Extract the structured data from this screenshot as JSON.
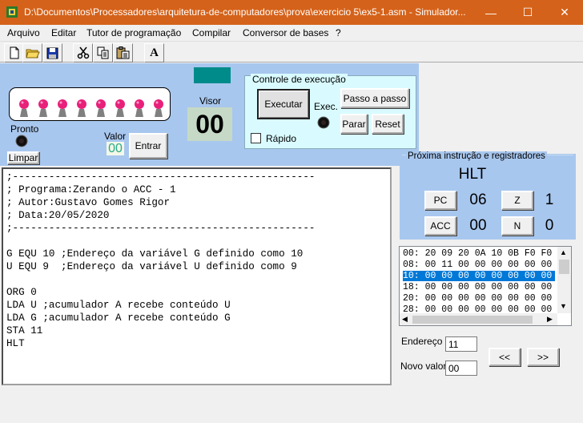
{
  "window": {
    "title": "D:\\Documentos\\Processadores\\arquitetura-de-computadores\\prova\\exercicio 5\\ex5-1.asm - Simulador...",
    "minimize": "—",
    "maximize": "☐",
    "close": "✕"
  },
  "menu": [
    "Arquivo",
    "Editar",
    "Tutor de programação",
    "Compilar",
    "Conversor de bases",
    "?"
  ],
  "toolbar": {
    "font_button": "A"
  },
  "io_panel": {
    "pronto_label": "Pronto",
    "limpar_button": "Limpar",
    "valor_label": "Valor",
    "valor_value": "00",
    "entrar_button": "Entrar",
    "visor_label": "Visor",
    "visor_value": "00"
  },
  "execution": {
    "group_title": "Controle de execução",
    "executar_button": "Executar",
    "exec_label": "Exec.",
    "passo_button": "Passo a passo",
    "parar_button": "Parar",
    "reset_button": "Reset",
    "rapido_label": "Rápido",
    "rapido_checked": false
  },
  "registers": {
    "group_title": "Próxima instrução e registradores",
    "instruction": "HLT",
    "pc_label": "PC",
    "pc_value": "06",
    "z_label": "Z",
    "z_value": "1",
    "acc_label": "ACC",
    "acc_value": "00",
    "n_label": "N",
    "n_value": "0"
  },
  "editor": {
    "lines": [
      ";--------------------------------------------------",
      "; Programa:Zerando o ACC - 1",
      "; Autor:Gustavo Gomes Rigor",
      "; Data:20/05/2020",
      ";--------------------------------------------------",
      "",
      "G EQU 10 ;Endereço da variável G definido como 10",
      "U EQU 9  ;Endereço da variável U definido como 9",
      "",
      "ORG 0",
      "LDA U ;acumulador A recebe conteúdo U",
      "LDA G ;acumulador A recebe conteúdo G",
      "STA 11",
      "HLT"
    ]
  },
  "memory": {
    "lines": [
      "00: 20 09 20 0A 10 0B F0 F0",
      "08: 00 11 00 00 00 00 00 00",
      "10: 00 00 00 00 00 00 00 00",
      "18: 00 00 00 00 00 00 00 00",
      "20: 00 00 00 00 00 00 00 00",
      "28: 00 00 00 00 00 00 00 00"
    ],
    "selected_index": 2
  },
  "memory_edit": {
    "endereco_label": "Endereço",
    "endereco_value": "11",
    "novo_valor_label": "Novo valor",
    "novo_valor_value": "00",
    "prev_button": "<<",
    "next_button": ">>"
  },
  "colors": {
    "titlebar": "#d5621a",
    "panel_blue": "#a8c7ee",
    "exec_panel": "#d9fbff",
    "display_bg": "#c6d9c6",
    "teal_indicator": "#008b8b",
    "selection": "#0078d7"
  }
}
